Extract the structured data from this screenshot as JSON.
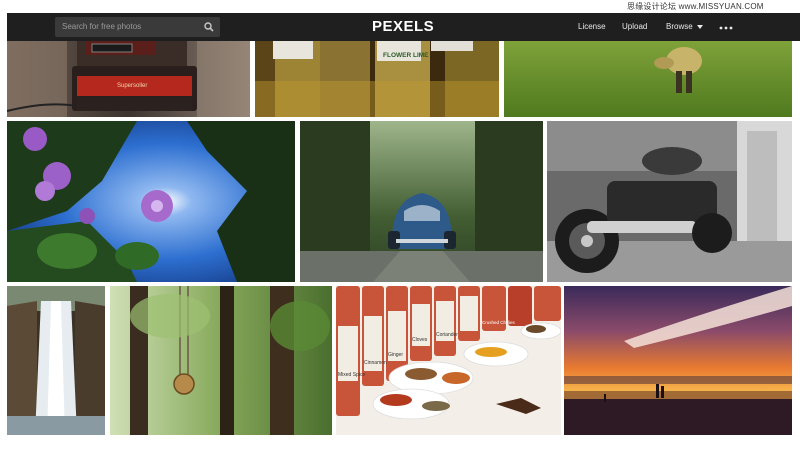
{
  "watermark": "思缘设计论坛 www.MISSYUAN.COM",
  "header": {
    "search_placeholder": "Search for free photos",
    "logo": "PEXELS",
    "nav": {
      "license": "License",
      "upload": "Upload",
      "browse": "Browse"
    },
    "icons": [
      "search-icon",
      "chevron-down-icon",
      "more-icon"
    ]
  },
  "photos": {
    "row1": [
      "camera",
      "lime-bottles",
      "dog-on-grass"
    ],
    "row2": [
      "purple-flowers",
      "blue-beetle-car",
      "motorcycle"
    ],
    "row3": [
      "waterfall",
      "forest-pendant",
      "spices",
      "sunset-beach"
    ]
  },
  "spice_labels": [
    "Mixed Spice",
    "Cinnamon",
    "Ginger",
    "Cloves",
    "Coriander",
    "Crushed Chillies"
  ],
  "camera_label": "Supersoller",
  "bottle_label": "FLOWER LIME",
  "colors": {
    "topbar": "#1f1f1f",
    "search_bg": "#3a3a3a",
    "logo_text": "#ffffff"
  }
}
